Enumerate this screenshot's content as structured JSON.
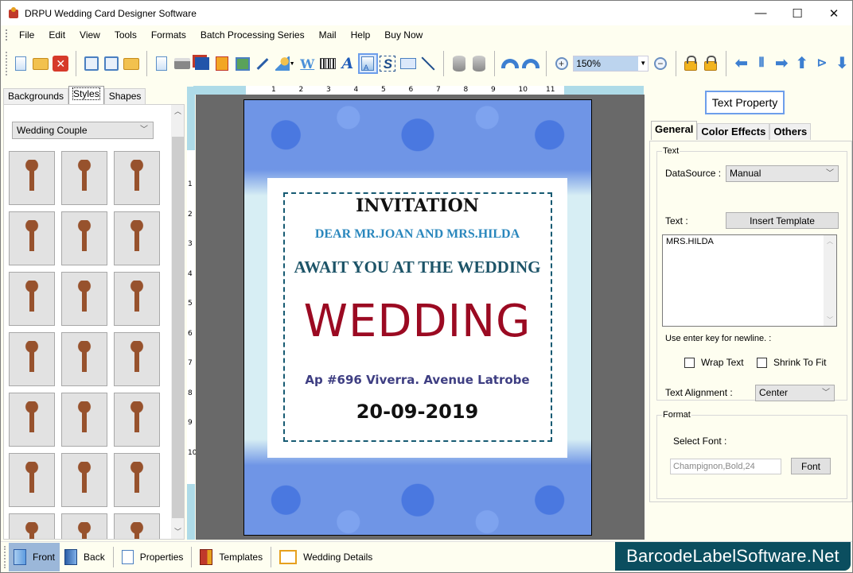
{
  "window": {
    "title": "DRPU Wedding Card Designer Software",
    "controls": {
      "minimize": "—",
      "maximize": "☐",
      "close": "✕"
    }
  },
  "menu": [
    "File",
    "Edit",
    "View",
    "Tools",
    "Formats",
    "Batch Processing Series",
    "Mail",
    "Help",
    "Buy Now"
  ],
  "toolbar": {
    "zoom_value": "150%"
  },
  "left_panel": {
    "tabs": [
      "Backgrounds",
      "Styles",
      "Shapes"
    ],
    "active_tab": "Styles",
    "category_select": "Wedding Couple",
    "thumbnails": [
      "bride-groom",
      "wedding-ceremony",
      "couple-kiss",
      "wedding-bells",
      "couple-cartoon",
      "ring",
      "bow-decoration",
      "wedding-dress",
      "bride-veil",
      "ballet-shoes",
      "ballet-pointe",
      "ballerina",
      "dancer-leap",
      "dancer-pose",
      "dancer-male",
      "dancer-couple",
      "dancer-woman",
      "dancer-statue",
      "couple-sitting",
      "santa-couple",
      "silhouette-couple"
    ]
  },
  "rulers": {
    "horizontal": [
      "1",
      "2",
      "3",
      "4",
      "5",
      "6",
      "7",
      "8",
      "9",
      "10",
      "11"
    ],
    "vertical": [
      "1",
      "2",
      "3",
      "4",
      "5",
      "6",
      "7",
      "8",
      "9",
      "10"
    ]
  },
  "card": {
    "invitation": "INVITATION",
    "dear": "DEAR MR.JOAN AND MRS.HILDA",
    "await": "AWAIT YOU AT THE WEDDING",
    "wedding": "WEDDING",
    "address": "Ap #696 Viverra. Avenue Latrobe",
    "date": "20-09-2019"
  },
  "right_panel": {
    "header_button": "Text Property",
    "tabs": [
      "General",
      "Color Effects",
      "Others"
    ],
    "active_tab": "General",
    "text_group": {
      "legend": "Text",
      "datasource_label": "DataSource :",
      "datasource_value": "Manual",
      "text_label": "Text :",
      "insert_template": "Insert Template",
      "text_value": "MRS.HILDA",
      "hint": "Use enter key for newline. :",
      "wrap_text": {
        "label": "Wrap Text",
        "checked": false
      },
      "shrink_to_fit": {
        "label": "Shrink To Fit",
        "checked": false
      },
      "alignment_label": "Text Alignment :",
      "alignment_value": "Center"
    },
    "format_group": {
      "legend": "Format",
      "select_font_label": "Select Font :",
      "font_value": "Champignon,Bold,24",
      "font_button": "Font"
    }
  },
  "bottom_bar": {
    "items": [
      "Front",
      "Back",
      "Properties",
      "Templates",
      "Wedding Details"
    ],
    "active": "Front"
  },
  "brand": "BarcodeLabelSoftware.Net"
}
